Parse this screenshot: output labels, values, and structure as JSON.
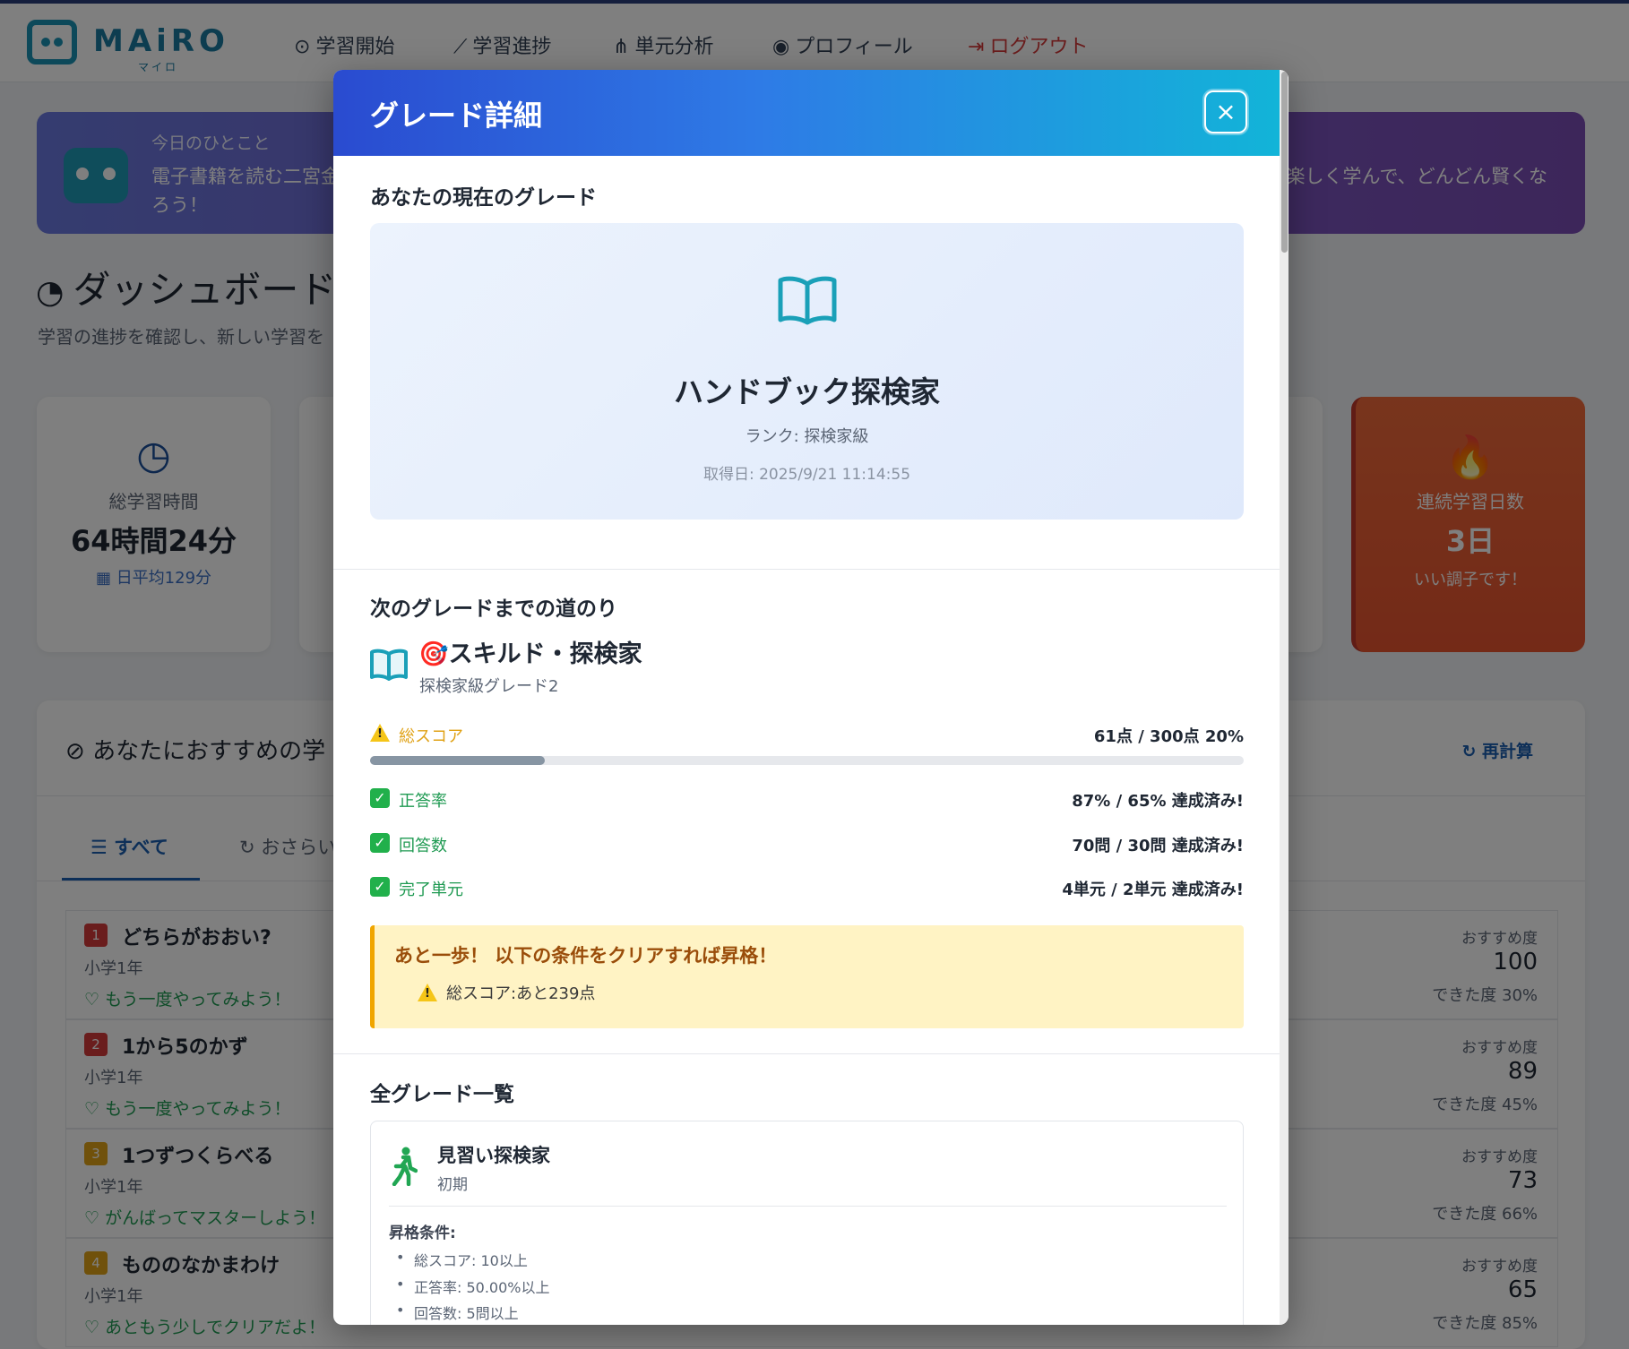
{
  "app": {
    "logo_text": "MAiRO",
    "logo_sub": "マイロ"
  },
  "nav": {
    "items": [
      {
        "label": "学習開始",
        "icon": "play-circle-icon"
      },
      {
        "label": "学習進捗",
        "icon": "line-chart-icon"
      },
      {
        "label": "単元分析",
        "icon": "sitemap-icon"
      },
      {
        "label": "プロフィール",
        "icon": "user-circle-icon"
      },
      {
        "label": "ログアウト",
        "icon": "logout-icon"
      }
    ]
  },
  "banner": {
    "small": "今日のひとこと",
    "text_left": "電子書籍を読む二宮金",
    "text_left2": "ろう！",
    "text_right": "楽しく学んで、どんどん賢くな"
  },
  "dashboard": {
    "title": "ダッシュボード",
    "subtitle": "学習の進捗を確認し、新しい学習を"
  },
  "stats": {
    "total_time": {
      "label": "総学習時間",
      "value": "64時間24分",
      "sub": "日平均129分"
    },
    "streak": {
      "label": "連続学習日数",
      "value": "3日",
      "sub": "いい調子です！"
    }
  },
  "recommend": {
    "title": "あなたにおすすめの学",
    "recalc": "再計算",
    "tab_all": "すべて",
    "tab_review": "おさらい",
    "items": [
      {
        "num": "1",
        "name": "どちらがおおい?",
        "grade": "小学1年",
        "hint": "もう一度やってみよう！",
        "score_label": "おすすめ度",
        "score": "100",
        "done": "できた度 30%",
        "color": "#d53b3b"
      },
      {
        "num": "2",
        "name": "1から5のかず",
        "grade": "小学1年",
        "hint": "もう一度やってみよう！",
        "score_label": "おすすめ度",
        "score": "89",
        "done": "できた度 45%",
        "color": "#d53b3b"
      },
      {
        "num": "3",
        "name": "1つずつくらべる",
        "grade": "小学1年",
        "hint": "がんばってマスターしよう！",
        "score_label": "おすすめ度",
        "score": "73",
        "done": "できた度 66%",
        "color": "#e0a216"
      },
      {
        "num": "4",
        "name": "もののなかまわけ",
        "grade": "小学1年",
        "hint": "あともう少しでクリアだよ！",
        "score_label": "おすすめ度",
        "score": "65",
        "done": "できた度 85%",
        "color": "#e0a216"
      }
    ]
  },
  "modal": {
    "title": "グレード詳細",
    "close_label": "×",
    "current_section": "あなたの現在のグレード",
    "current": {
      "name": "ハンドブック探検家",
      "rank": "ランク: 探検家級",
      "date": "取得日: 2025/9/21 11:14:55"
    },
    "next_section": "次のグレードまでの道のり",
    "next": {
      "emoji": "🎯",
      "name": "スキルド・探検家",
      "sub": "探検家級グレード2"
    },
    "conditions": [
      {
        "name": "総スコア",
        "value": "61点 / 300点 20%",
        "status": "warning",
        "color": "#e0a216"
      },
      {
        "name": "正答率",
        "value": "87% / 65% 達成済み!",
        "status": "done",
        "color": "#1f9a52"
      },
      {
        "name": "回答数",
        "value": "70問 / 30問 達成済み!",
        "status": "done",
        "color": "#1f9a52"
      },
      {
        "name": "完了単元",
        "value": "4単元 / 2単元 達成済み!",
        "status": "done",
        "color": "#1f9a52"
      }
    ],
    "score_progress": 0.2,
    "notice": {
      "title": "あと一歩！ 以下の条件をクリアすれば昇格！",
      "item": "総スコア:あと239点"
    },
    "all_section": "全グレード一覧",
    "grade_card": {
      "name": "見習い探検家",
      "sub": "初期",
      "req_title": "昇格条件:",
      "reqs": [
        "総スコア: 10以上",
        "正答率: 50.00%以上",
        "回答数: 5問以上"
      ]
    }
  }
}
